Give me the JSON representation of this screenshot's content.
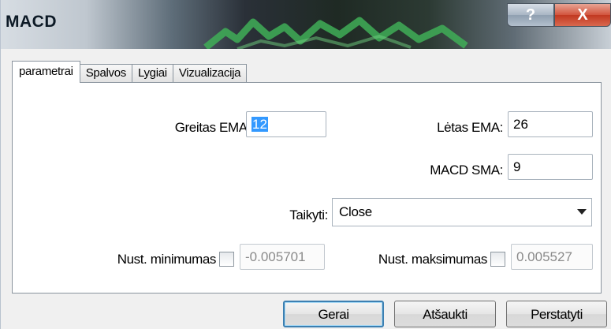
{
  "window": {
    "title": "MACD",
    "help_glyph": "?",
    "close_glyph": "X"
  },
  "tabs": [
    {
      "label": "parametrai",
      "active": true
    },
    {
      "label": "Spalvos",
      "active": false
    },
    {
      "label": "Lygiai",
      "active": false
    },
    {
      "label": "Vizualizacija",
      "active": false
    }
  ],
  "params": {
    "fast_ema_label": "Greitas EMA:",
    "fast_ema_value": "12",
    "slow_ema_label": "Lėtas EMA:",
    "slow_ema_value": "26",
    "macd_sma_label": "MACD SMA:",
    "macd_sma_value": "9",
    "apply_label": "Taikyti:",
    "apply_value": "Close",
    "min_label": "Nust. minimumas",
    "min_value": "-0.005701",
    "max_label": "Nust. maksimumas",
    "max_value": "0.005527"
  },
  "buttons": {
    "ok": "Gerai",
    "cancel": "Atšaukti",
    "reset": "Perstatyti"
  },
  "colors": {
    "selection": "#3399ff",
    "close_button": "#c13820",
    "default_button_border": "#3c7fb1"
  }
}
